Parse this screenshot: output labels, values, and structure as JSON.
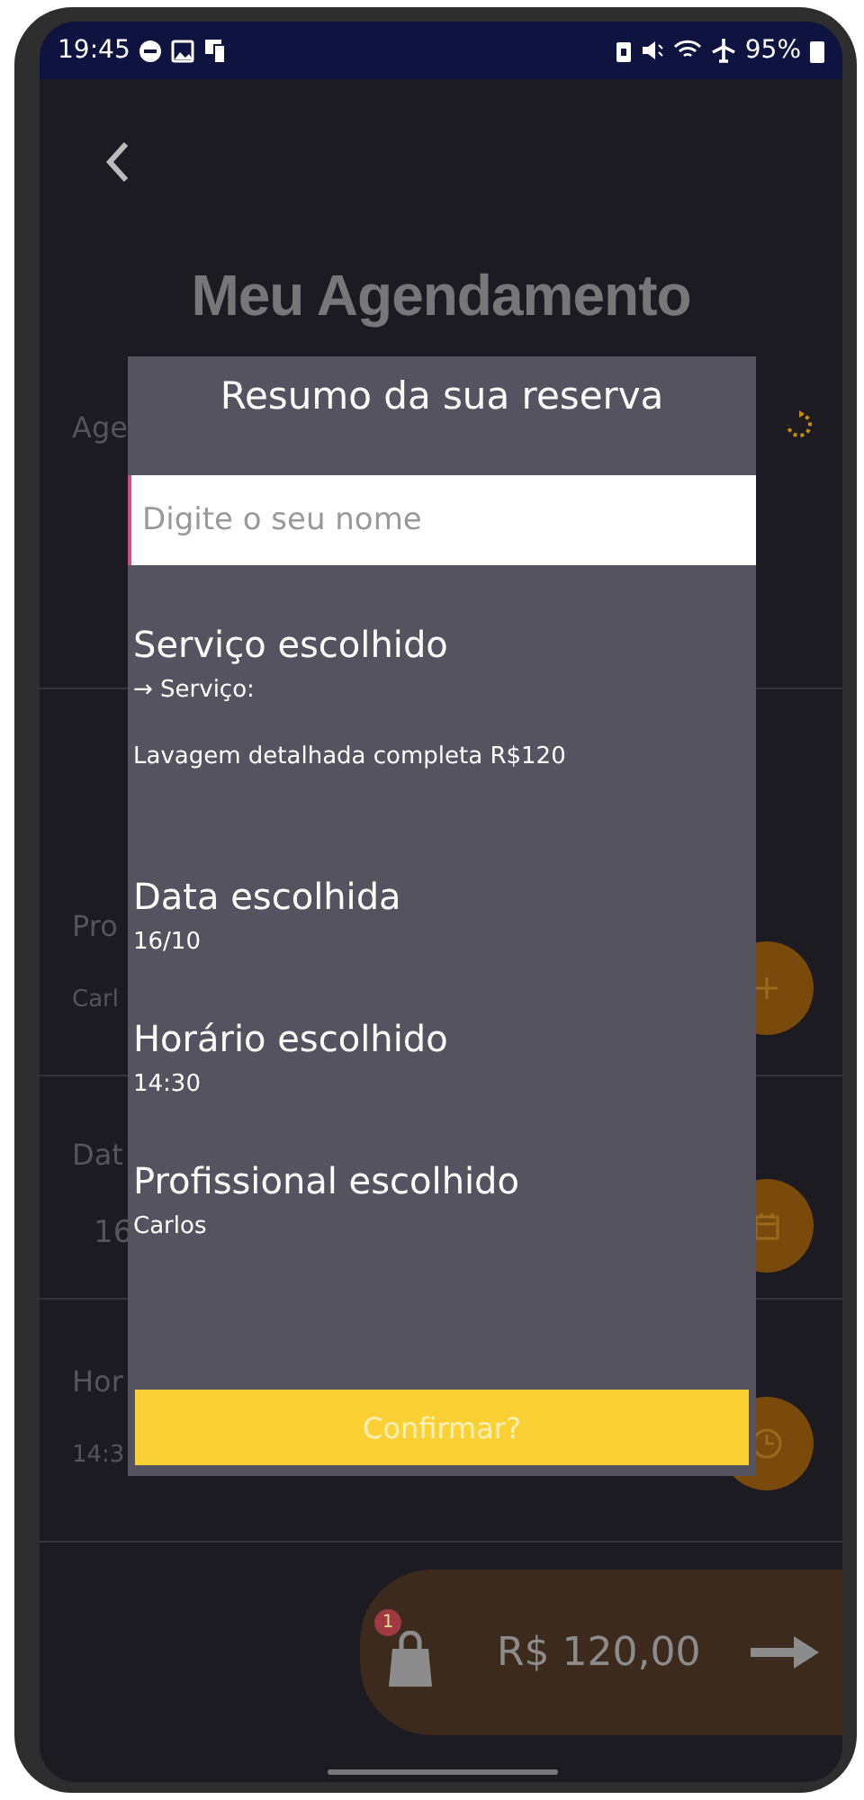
{
  "status_bar": {
    "time": "19:45",
    "battery": "95%"
  },
  "header": {
    "title": "Meu Agendamento"
  },
  "background_rows": [
    {
      "kind": "refresh",
      "label": "Age"
    },
    {
      "kind": "add",
      "label": "Pro",
      "value": "Carl"
    },
    {
      "kind": "calendar",
      "label": "Dat",
      "value": "16"
    },
    {
      "kind": "clock",
      "label": "Hor",
      "value": "14:3"
    }
  ],
  "cart": {
    "badge": "1",
    "total": "R$ 120,00"
  },
  "modal": {
    "title": "Resumo da sua reserva",
    "name_field": {
      "placeholder": "Digite o seu nome"
    },
    "sections": [
      {
        "heading": "Serviço escolhido",
        "lines": [
          "→ Serviço:",
          "Lavagem detalhada completa R$120"
        ]
      },
      {
        "heading": "Data escolhida",
        "lines": [
          "16/10"
        ]
      },
      {
        "heading": "Horário escolhido",
        "lines": [
          "14:30"
        ]
      },
      {
        "heading": "Profissional escolhido",
        "lines": [
          "Carlos"
        ]
      }
    ],
    "confirm_button": "Confirmar?"
  }
}
